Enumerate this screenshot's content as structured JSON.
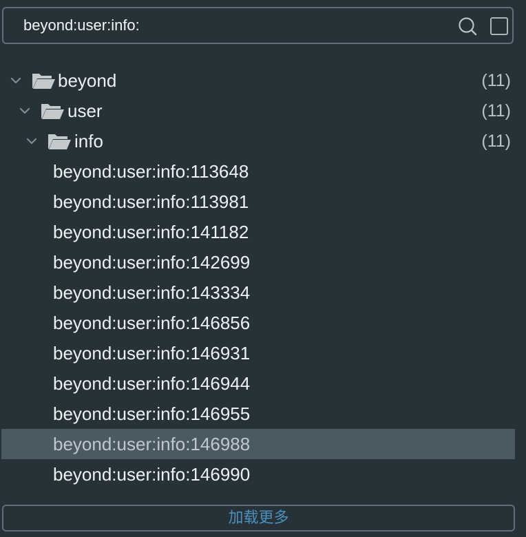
{
  "search": {
    "value": "beyond:user:info:",
    "icon": "search-icon",
    "checkbox_icon": "checkbox-icon"
  },
  "tree": {
    "folders": [
      {
        "label": "beyond",
        "count": "(11)"
      },
      {
        "label": "user",
        "count": "(11)"
      },
      {
        "label": "info",
        "count": "(11)"
      }
    ],
    "keys": [
      "beyond:user:info:113648",
      "beyond:user:info:113981",
      "beyond:user:info:141182",
      "beyond:user:info:142699",
      "beyond:user:info:143334",
      "beyond:user:info:146856",
      "beyond:user:info:146931",
      "beyond:user:info:146944",
      "beyond:user:info:146955",
      "beyond:user:info:146988",
      "beyond:user:info:146990"
    ],
    "selected_key": "beyond:user:info:146988"
  },
  "footer": {
    "load_more_label": "加载更多"
  },
  "colors": {
    "background": "#263238",
    "border": "#5f6f79",
    "selected_row": "#4a5962",
    "link": "#4d8fbd"
  }
}
